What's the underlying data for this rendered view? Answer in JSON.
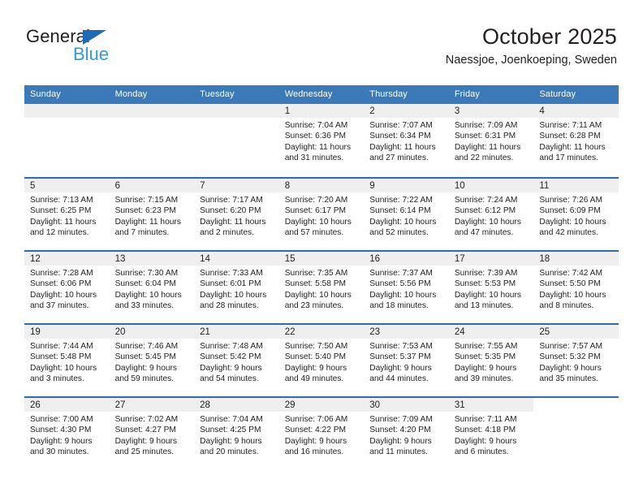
{
  "brand": {
    "line1": "General",
    "line2": "Blue",
    "triangle_color": "#1f6cb4",
    "line2_color": "#2e9ae2"
  },
  "header": {
    "title": "October 2025",
    "location": "Naessjoe, Joenkoeping, Sweden"
  },
  "theme": {
    "header_bg": "#3b79b8",
    "row_divider": "#2f6ca8",
    "daynum_band": "#efefef",
    "text": "#231f20"
  },
  "weekday_headers": [
    "Sunday",
    "Monday",
    "Tuesday",
    "Wednesday",
    "Thursday",
    "Friday",
    "Saturday"
  ],
  "weeks": [
    [
      {
        "day": "",
        "lines": []
      },
      {
        "day": "",
        "lines": []
      },
      {
        "day": "",
        "lines": []
      },
      {
        "day": "1",
        "lines": [
          "Sunrise: 7:04 AM",
          "Sunset: 6:36 PM",
          "Daylight: 11 hours",
          "and 31 minutes."
        ]
      },
      {
        "day": "2",
        "lines": [
          "Sunrise: 7:07 AM",
          "Sunset: 6:34 PM",
          "Daylight: 11 hours",
          "and 27 minutes."
        ]
      },
      {
        "day": "3",
        "lines": [
          "Sunrise: 7:09 AM",
          "Sunset: 6:31 PM",
          "Daylight: 11 hours",
          "and 22 minutes."
        ]
      },
      {
        "day": "4",
        "lines": [
          "Sunrise: 7:11 AM",
          "Sunset: 6:28 PM",
          "Daylight: 11 hours",
          "and 17 minutes."
        ]
      }
    ],
    [
      {
        "day": "5",
        "lines": [
          "Sunrise: 7:13 AM",
          "Sunset: 6:25 PM",
          "Daylight: 11 hours",
          "and 12 minutes."
        ]
      },
      {
        "day": "6",
        "lines": [
          "Sunrise: 7:15 AM",
          "Sunset: 6:23 PM",
          "Daylight: 11 hours",
          "and 7 minutes."
        ]
      },
      {
        "day": "7",
        "lines": [
          "Sunrise: 7:17 AM",
          "Sunset: 6:20 PM",
          "Daylight: 11 hours",
          "and 2 minutes."
        ]
      },
      {
        "day": "8",
        "lines": [
          "Sunrise: 7:20 AM",
          "Sunset: 6:17 PM",
          "Daylight: 10 hours",
          "and 57 minutes."
        ]
      },
      {
        "day": "9",
        "lines": [
          "Sunrise: 7:22 AM",
          "Sunset: 6:14 PM",
          "Daylight: 10 hours",
          "and 52 minutes."
        ]
      },
      {
        "day": "10",
        "lines": [
          "Sunrise: 7:24 AM",
          "Sunset: 6:12 PM",
          "Daylight: 10 hours",
          "and 47 minutes."
        ]
      },
      {
        "day": "11",
        "lines": [
          "Sunrise: 7:26 AM",
          "Sunset: 6:09 PM",
          "Daylight: 10 hours",
          "and 42 minutes."
        ]
      }
    ],
    [
      {
        "day": "12",
        "lines": [
          "Sunrise: 7:28 AM",
          "Sunset: 6:06 PM",
          "Daylight: 10 hours",
          "and 37 minutes."
        ]
      },
      {
        "day": "13",
        "lines": [
          "Sunrise: 7:30 AM",
          "Sunset: 6:04 PM",
          "Daylight: 10 hours",
          "and 33 minutes."
        ]
      },
      {
        "day": "14",
        "lines": [
          "Sunrise: 7:33 AM",
          "Sunset: 6:01 PM",
          "Daylight: 10 hours",
          "and 28 minutes."
        ]
      },
      {
        "day": "15",
        "lines": [
          "Sunrise: 7:35 AM",
          "Sunset: 5:58 PM",
          "Daylight: 10 hours",
          "and 23 minutes."
        ]
      },
      {
        "day": "16",
        "lines": [
          "Sunrise: 7:37 AM",
          "Sunset: 5:56 PM",
          "Daylight: 10 hours",
          "and 18 minutes."
        ]
      },
      {
        "day": "17",
        "lines": [
          "Sunrise: 7:39 AM",
          "Sunset: 5:53 PM",
          "Daylight: 10 hours",
          "and 13 minutes."
        ]
      },
      {
        "day": "18",
        "lines": [
          "Sunrise: 7:42 AM",
          "Sunset: 5:50 PM",
          "Daylight: 10 hours",
          "and 8 minutes."
        ]
      }
    ],
    [
      {
        "day": "19",
        "lines": [
          "Sunrise: 7:44 AM",
          "Sunset: 5:48 PM",
          "Daylight: 10 hours",
          "and 3 minutes."
        ]
      },
      {
        "day": "20",
        "lines": [
          "Sunrise: 7:46 AM",
          "Sunset: 5:45 PM",
          "Daylight: 9 hours",
          "and 59 minutes."
        ]
      },
      {
        "day": "21",
        "lines": [
          "Sunrise: 7:48 AM",
          "Sunset: 5:42 PM",
          "Daylight: 9 hours",
          "and 54 minutes."
        ]
      },
      {
        "day": "22",
        "lines": [
          "Sunrise: 7:50 AM",
          "Sunset: 5:40 PM",
          "Daylight: 9 hours",
          "and 49 minutes."
        ]
      },
      {
        "day": "23",
        "lines": [
          "Sunrise: 7:53 AM",
          "Sunset: 5:37 PM",
          "Daylight: 9 hours",
          "and 44 minutes."
        ]
      },
      {
        "day": "24",
        "lines": [
          "Sunrise: 7:55 AM",
          "Sunset: 5:35 PM",
          "Daylight: 9 hours",
          "and 39 minutes."
        ]
      },
      {
        "day": "25",
        "lines": [
          "Sunrise: 7:57 AM",
          "Sunset: 5:32 PM",
          "Daylight: 9 hours",
          "and 35 minutes."
        ]
      }
    ],
    [
      {
        "day": "26",
        "lines": [
          "Sunrise: 7:00 AM",
          "Sunset: 4:30 PM",
          "Daylight: 9 hours",
          "and 30 minutes."
        ]
      },
      {
        "day": "27",
        "lines": [
          "Sunrise: 7:02 AM",
          "Sunset: 4:27 PM",
          "Daylight: 9 hours",
          "and 25 minutes."
        ]
      },
      {
        "day": "28",
        "lines": [
          "Sunrise: 7:04 AM",
          "Sunset: 4:25 PM",
          "Daylight: 9 hours",
          "and 20 minutes."
        ]
      },
      {
        "day": "29",
        "lines": [
          "Sunrise: 7:06 AM",
          "Sunset: 4:22 PM",
          "Daylight: 9 hours",
          "and 16 minutes."
        ]
      },
      {
        "day": "30",
        "lines": [
          "Sunrise: 7:09 AM",
          "Sunset: 4:20 PM",
          "Daylight: 9 hours",
          "and 11 minutes."
        ]
      },
      {
        "day": "31",
        "lines": [
          "Sunrise: 7:11 AM",
          "Sunset: 4:18 PM",
          "Daylight: 9 hours",
          "and 6 minutes."
        ]
      },
      {
        "day": "",
        "lines": []
      }
    ]
  ]
}
